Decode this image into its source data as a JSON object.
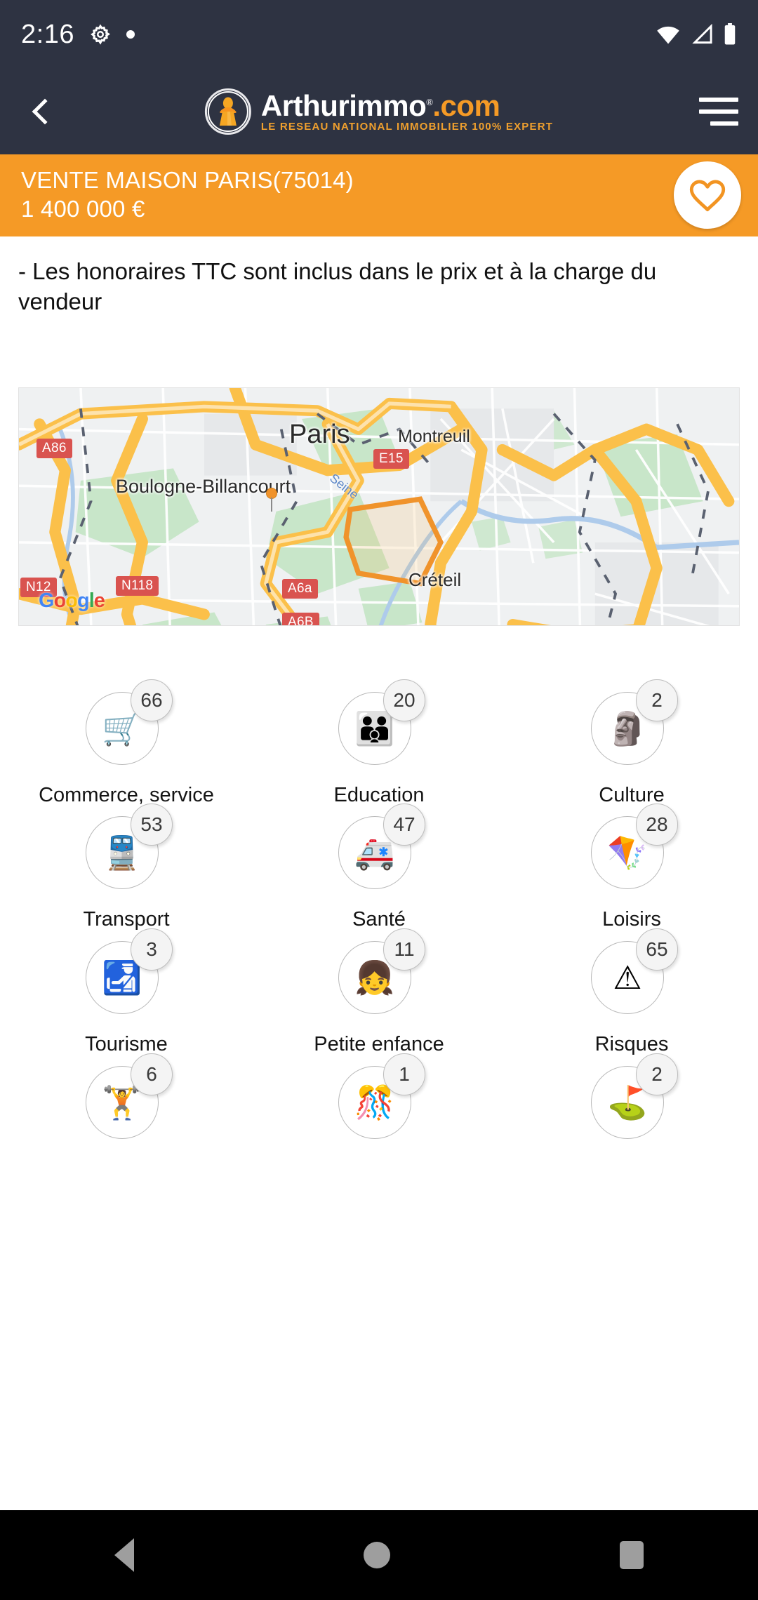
{
  "status_bar": {
    "time": "2:16",
    "icons_left": [
      "gear-icon",
      "dot-indicator"
    ],
    "icons_right": [
      "wifi-icon",
      "signal-icon",
      "battery-icon"
    ]
  },
  "header": {
    "back_label": "‹",
    "logo": {
      "name": "Arthurimmo",
      "suffix": ".com",
      "registered": "®",
      "tagline": "LE RESEAU NATIONAL IMMOBILIER 100% EXPERT"
    },
    "menu_label": "menu"
  },
  "banner": {
    "title": "VENTE MAISON  PARIS(75014)",
    "price": "1 400 000 €",
    "favorite_icon": "heart-icon",
    "background_color": "#f59a26"
  },
  "description": {
    "text": "- Les honoraires TTC sont inclus dans le prix et à la charge du vendeur"
  },
  "map": {
    "provider": "Google",
    "provider_letters": [
      "G",
      "o",
      "o",
      "g",
      "l",
      "e"
    ],
    "city_labels": [
      {
        "name": "Paris"
      },
      {
        "name": "Boulogne-Billancourt"
      },
      {
        "name": "Montreuil"
      },
      {
        "name": "Créteil"
      }
    ],
    "river_label": "Seine",
    "road_badges": [
      "A86",
      "N12",
      "N118",
      "A6a",
      "A6B",
      "E15"
    ],
    "marker": "property-pin"
  },
  "poi": {
    "items": [
      {
        "label": "Commerce, service",
        "count": "66",
        "icon": "shopping-cart-icon",
        "glyph": "🛒"
      },
      {
        "label": "Education",
        "count": "20",
        "icon": "family-icon",
        "glyph": "👪"
      },
      {
        "label": "Culture",
        "count": "2",
        "icon": "mask-icon",
        "glyph": "🗿"
      },
      {
        "label": "Transport",
        "count": "53",
        "icon": "train-icon",
        "glyph": "🚆"
      },
      {
        "label": "Santé",
        "count": "47",
        "icon": "first-aid-kit-icon",
        "glyph": "🚑"
      },
      {
        "label": "Loisirs",
        "count": "28",
        "icon": "kite-icon",
        "glyph": "🪁"
      },
      {
        "label": "Tourisme",
        "count": "3",
        "icon": "globe-plane-icon",
        "glyph": "🛃"
      },
      {
        "label": "Petite enfance",
        "count": "11",
        "icon": "child-icon",
        "glyph": "👧"
      },
      {
        "label": "Risques",
        "count": "65",
        "icon": "warning-triangle-icon",
        "glyph": "⚠"
      },
      {
        "label": "",
        "count": "6",
        "icon": "dumbbell-icon",
        "glyph": "🏋"
      },
      {
        "label": "",
        "count": "1",
        "icon": "celebration-icon",
        "glyph": "🎊"
      },
      {
        "label": "",
        "count": "2",
        "icon": "golf-flag-icon",
        "glyph": "⛳"
      }
    ]
  },
  "nav_bar": {
    "back": "back-triangle-icon",
    "home": "home-circle-icon",
    "recents": "recents-square-icon"
  }
}
